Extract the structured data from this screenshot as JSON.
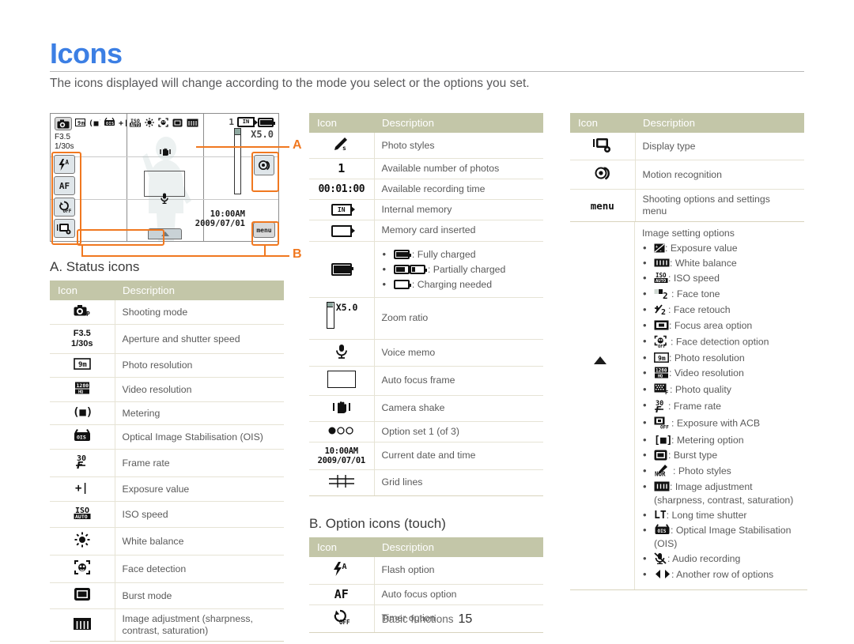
{
  "page": {
    "title": "Icons",
    "intro": "The icons displayed will change according to the mode you select or the options you set.",
    "footer_label": "Basic functions",
    "footer_page": "15",
    "accent_blue": "#3c7fe4",
    "accent_orange": "#f07820",
    "table_header_bg": "#c3c6a8"
  },
  "lcd": {
    "mode_icon": "shooting-mode-icon",
    "aperture": "F3.5",
    "shutter": "1/30s",
    "available_photos": "1",
    "zoom_ratio": "X5.0",
    "time": "10:00AM",
    "date": "2009/07/01",
    "menu_label": "menu",
    "flash_label": "A",
    "af_label": "AF",
    "timer_label": "OFF",
    "callout_a": "A",
    "callout_b": "B"
  },
  "section_a": {
    "heading": "A. Status icons",
    "columns": [
      "Icon",
      "Description"
    ],
    "rows": [
      {
        "icon": "shooting-mode-icon",
        "desc": "Shooting mode"
      },
      {
        "icon": "aperture-shutter-icon",
        "icon_text": "F3.5 / 1/30s",
        "desc": "Aperture and shutter speed"
      },
      {
        "icon": "photo-resolution-icon",
        "desc": "Photo resolution"
      },
      {
        "icon": "video-resolution-icon",
        "desc": "Video resolution"
      },
      {
        "icon": "metering-icon",
        "desc": "Metering"
      },
      {
        "icon": "ois-icon",
        "desc": "Optical Image Stabilisation (OIS)"
      },
      {
        "icon": "frame-rate-icon",
        "desc": "Frame rate"
      },
      {
        "icon": "exposure-value-icon",
        "desc": "Exposure value"
      },
      {
        "icon": "iso-speed-icon",
        "desc": "ISO speed"
      },
      {
        "icon": "white-balance-icon",
        "desc": "White balance"
      },
      {
        "icon": "face-detection-icon",
        "desc": "Face detection"
      },
      {
        "icon": "burst-mode-icon",
        "desc": "Burst mode"
      },
      {
        "icon": "image-adjustment-icon",
        "desc": "Image adjustment (sharpness, contrast, saturation)"
      }
    ]
  },
  "section_mid": {
    "columns": [
      "Icon",
      "Description"
    ],
    "rows": [
      {
        "icon": "photo-styles-icon",
        "desc": "Photo styles"
      },
      {
        "icon": "available-photos-icon",
        "desc": "Available number of photos"
      },
      {
        "icon": "recording-time-icon",
        "icon_text": "00:01:00",
        "desc": "Available recording time"
      },
      {
        "icon": "internal-memory-icon",
        "desc": "Internal memory"
      },
      {
        "icon": "memory-card-icon",
        "desc": "Memory card inserted"
      },
      {
        "icon": "battery-icon",
        "desc": "",
        "bullets": [
          {
            "icon": "battery-full-icon",
            "text": ": Fully charged"
          },
          {
            "icon": "battery-partial-icon",
            "text": ": Partially charged"
          },
          {
            "icon": "battery-empty-icon",
            "text": ": Charging needed"
          }
        ]
      },
      {
        "icon": "zoom-ratio-icon",
        "icon_text": "X5.0",
        "desc": "Zoom ratio"
      },
      {
        "icon": "voice-memo-icon",
        "desc": "Voice memo"
      },
      {
        "icon": "auto-focus-frame-icon",
        "desc": "Auto focus frame"
      },
      {
        "icon": "camera-shake-icon",
        "desc": "Camera shake"
      },
      {
        "icon": "option-set-icon",
        "desc": "Option set 1 (of 3)"
      },
      {
        "icon": "date-time-icon",
        "icon_text": "10:00 AM / 2009/07/01",
        "desc": "Current date and time"
      },
      {
        "icon": "grid-lines-icon",
        "desc": "Grid lines"
      }
    ]
  },
  "section_b": {
    "heading": "B. Option icons (touch)",
    "columns": [
      "Icon",
      "Description"
    ],
    "rows": [
      {
        "icon": "flash-option-icon",
        "desc": "Flash option"
      },
      {
        "icon": "auto-focus-option-icon",
        "desc": "Auto focus option"
      },
      {
        "icon": "timer-option-icon",
        "desc": "Timer option"
      }
    ]
  },
  "section_right": {
    "columns": [
      "Icon",
      "Description"
    ],
    "rows": [
      {
        "icon": "display-type-icon",
        "desc": "Display type"
      },
      {
        "icon": "motion-recognition-icon",
        "desc": "Motion recognition"
      },
      {
        "icon": "menu-icon",
        "icon_text": "menu",
        "desc": "Shooting options and settings menu"
      }
    ],
    "image_setting_lead": "Image setting options",
    "image_setting_options": [
      {
        "icon": "exposure-value-icon",
        "text": ": Exposure value"
      },
      {
        "icon": "white-balance-icon",
        "text": ": White balance"
      },
      {
        "icon": "iso-speed-icon",
        "text": ": ISO speed"
      },
      {
        "icon": "face-tone-icon",
        "text": ": Face tone"
      },
      {
        "icon": "face-retouch-icon",
        "text": ": Face retouch"
      },
      {
        "icon": "focus-area-icon",
        "text": ": Focus area option"
      },
      {
        "icon": "face-detection-option-icon",
        "text": ": Face detection option"
      },
      {
        "icon": "photo-resolution-icon",
        "text": ": Photo resolution"
      },
      {
        "icon": "video-resolution-icon",
        "text": ": Video resolution"
      },
      {
        "icon": "photo-quality-icon",
        "text": ": Photo quality"
      },
      {
        "icon": "frame-rate-icon",
        "text": ": Frame rate"
      },
      {
        "icon": "exposure-acb-icon",
        "text": ": Exposure with ACB"
      },
      {
        "icon": "metering-option-icon",
        "text": ": Metering option"
      },
      {
        "icon": "burst-type-icon",
        "text": ": Burst type"
      },
      {
        "icon": "photo-styles-nor-icon",
        "text": ": Photo styles"
      },
      {
        "icon": "image-adjustment-icon",
        "text": ": Image adjustment (sharpness, contrast, saturation)"
      },
      {
        "icon": "long-time-shutter-icon",
        "text": ": Long time shutter"
      },
      {
        "icon": "ois-icon",
        "text": ": Optical Image Stabilisation (OIS)"
      },
      {
        "icon": "audio-recording-icon",
        "text": ": Audio recording"
      },
      {
        "icon": "another-row-icon",
        "text": ": Another row of options"
      }
    ]
  }
}
